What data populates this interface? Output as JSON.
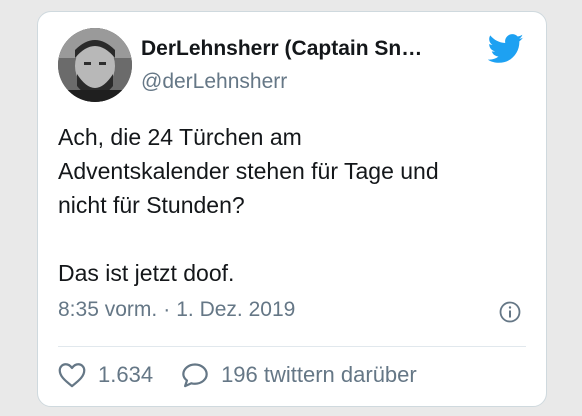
{
  "author": {
    "display_name": "DerLehnsherr (Captain Sn…",
    "handle": "@derLehnsherr"
  },
  "tweet": {
    "lines": [
      "Ach, die 24 Türchen am",
      "Adventskalender stehen für Tage und",
      "nicht für Stunden?"
    ],
    "last_line": "Das ist jetzt doof.",
    "time": "8:35 vorm.",
    "separator": "·",
    "date": "1. Dez. 2019"
  },
  "actions": {
    "likes": "1.634",
    "replies_label": "196 twittern darüber"
  },
  "colors": {
    "twitter_blue": "#1da1f2",
    "secondary_text": "#657786"
  },
  "icons": [
    "twitter-bird-icon",
    "info-icon",
    "heart-icon",
    "speech-bubble-icon"
  ]
}
